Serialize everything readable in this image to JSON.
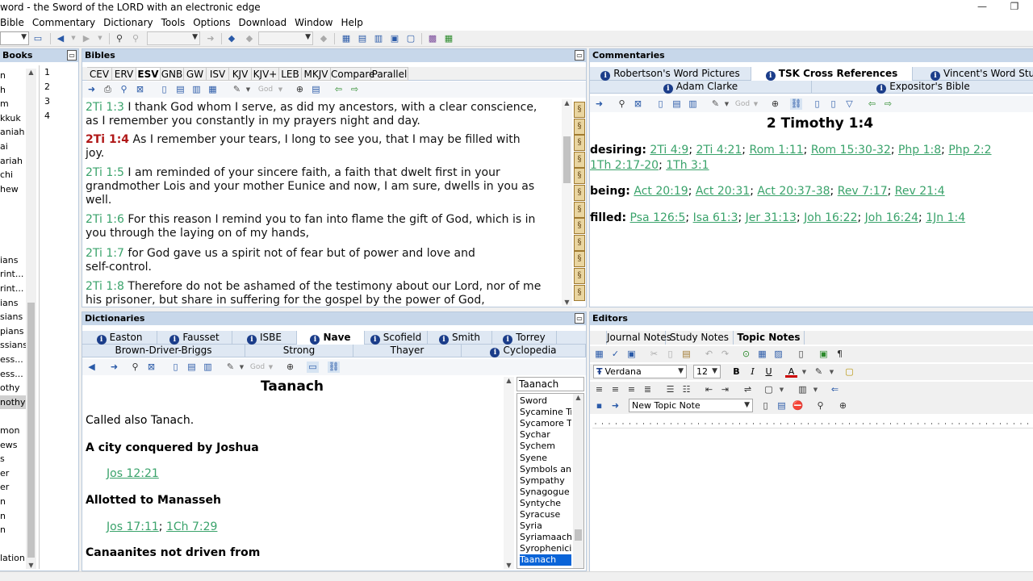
{
  "window": {
    "title": "word - the Sword of the LORD with an electronic edge"
  },
  "menu": [
    "Bible",
    "Commentary",
    "Dictionary",
    "Tools",
    "Options",
    "Download",
    "Window",
    "Help"
  ],
  "books": {
    "header": "Books",
    "items": [
      "n",
      "h",
      "m",
      "kkuk",
      "aniah",
      "ai",
      "ariah",
      "chi",
      "hew",
      "",
      "",
      "",
      "",
      "ians",
      "rint...",
      "rint...",
      "ians",
      "sians",
      "pians",
      "ssians",
      "ess...",
      "ess...",
      "othy",
      "nothy",
      "",
      "mon",
      "ews",
      "s",
      "er",
      "er",
      "n",
      "n",
      "n",
      "",
      "lation"
    ],
    "selected_index": 23,
    "chapters": [
      "1",
      "2",
      "3",
      "4"
    ]
  },
  "bibles": {
    "header": "Bibles",
    "tabs": [
      "CEV",
      "ERV",
      "ESV",
      "GNB",
      "GW",
      "ISV",
      "KJV",
      "KJV+",
      "LEB",
      "MKJV",
      "Compare",
      "Parallel"
    ],
    "active_tab": "ESV",
    "verses": [
      {
        "ref": "2Ti 1:3",
        "text": "I thank God whom I serve, as did my ancestors, with a clear conscience,",
        "text2": "as I remember you constantly in my prayers night and day.",
        "current": false
      },
      {
        "ref": "2Ti 1:4",
        "text": "As I remember your tears, I long to see you, that I may be filled with",
        "text2": "joy.",
        "current": true
      },
      {
        "ref": "2Ti 1:5",
        "text": "I am reminded of your sincere faith, a faith that dwelt first in your",
        "text2": "grandmother Lois and your mother Eunice and now, I am sure, dwells in you as",
        "text3": "well.",
        "current": false
      },
      {
        "ref": "2Ti 1:6",
        "text": "For this reason I remind you to fan into flame the gift of God, which is in",
        "text2": "you through the laying on of my hands,",
        "current": false
      },
      {
        "ref": "2Ti 1:7",
        "text": "for God gave us a spirit not of fear but of power and love and",
        "text2": "self-control.",
        "current": false
      },
      {
        "ref": "2Ti 1:8",
        "text": "Therefore do not be ashamed of the testimony about our Lord, nor of me",
        "text2": "his prisoner, but share in suffering for the gospel by the power of God,",
        "current": false
      }
    ],
    "toolbar_god": "God"
  },
  "commentaries": {
    "header": "Commentaries",
    "tabs_row1": [
      "Robertson's Word Pictures",
      "TSK Cross References",
      "Vincent's Word Studi"
    ],
    "tabs_row2": [
      "Adam Clarke",
      "Expositor's Bible"
    ],
    "active_tab": "TSK Cross References",
    "title": "2 Timothy 1:4",
    "entries": [
      {
        "label": "desiring:",
        "refs": [
          "2Ti 4:9",
          "2Ti 4:21",
          "Rom 1:11",
          "Rom 15:30-32",
          "Php 1:8",
          "Php 2:2"
        ],
        "refs2": [
          "1Th 2:17-20",
          "1Th 3:1"
        ]
      },
      {
        "label": "being:",
        "refs": [
          "Act 20:19",
          "Act 20:31",
          "Act 20:37-38",
          "Rev 7:17",
          "Rev 21:4"
        ]
      },
      {
        "label": "filled:",
        "refs": [
          "Psa 126:5",
          "Isa 61:3",
          "Jer 31:13",
          "Joh 16:22",
          "Joh 16:24",
          "1Jn 1:4"
        ]
      }
    ]
  },
  "dictionaries": {
    "header": "Dictionaries",
    "tabs_row1": [
      "Easton",
      "Fausset",
      "ISBE",
      "Nave",
      "Scofield",
      "Smith",
      "Torrey"
    ],
    "tabs_row2": [
      "Brown-Driver-Briggs",
      "Strong",
      "Thayer",
      "Cyclopedia"
    ],
    "active_tab": "Nave",
    "entry_title": "Taanach",
    "body": [
      {
        "kind": "text",
        "value": "Called also Tanach."
      },
      {
        "kind": "heading",
        "value": "A city conquered by Joshua"
      },
      {
        "kind": "refs",
        "value": [
          "Jos 12:21"
        ]
      },
      {
        "kind": "heading",
        "value": "Allotted to Manasseh"
      },
      {
        "kind": "refs",
        "value": [
          "Jos 17:11",
          "1Ch 7:29"
        ]
      },
      {
        "kind": "heading",
        "value": "Canaanites not driven from"
      }
    ],
    "search_value": "Taanach",
    "list": [
      "Sword",
      "Sycamine Tr",
      "Sycamore Tr",
      "Sychar",
      "Sychem",
      "Syene",
      "Symbols and",
      "Sympathy",
      "Synagogue",
      "Syntyche",
      "Syracuse",
      "Syria",
      "Syriamaacha",
      "Syrophenicia",
      "Taanach"
    ],
    "selected": "Taanach"
  },
  "editors": {
    "header": "Editors",
    "tabs": [
      "Journal Notes",
      "Study Notes",
      "Topic Notes"
    ],
    "active_tab": "Topic Notes",
    "font": "Verdana",
    "size": "12",
    "note": "New Topic Note"
  },
  "colors": {
    "panel_header": "#c7d7ea",
    "link": "#3aa36b",
    "current_ref": "#b01818",
    "selection": "#0a64d8"
  }
}
